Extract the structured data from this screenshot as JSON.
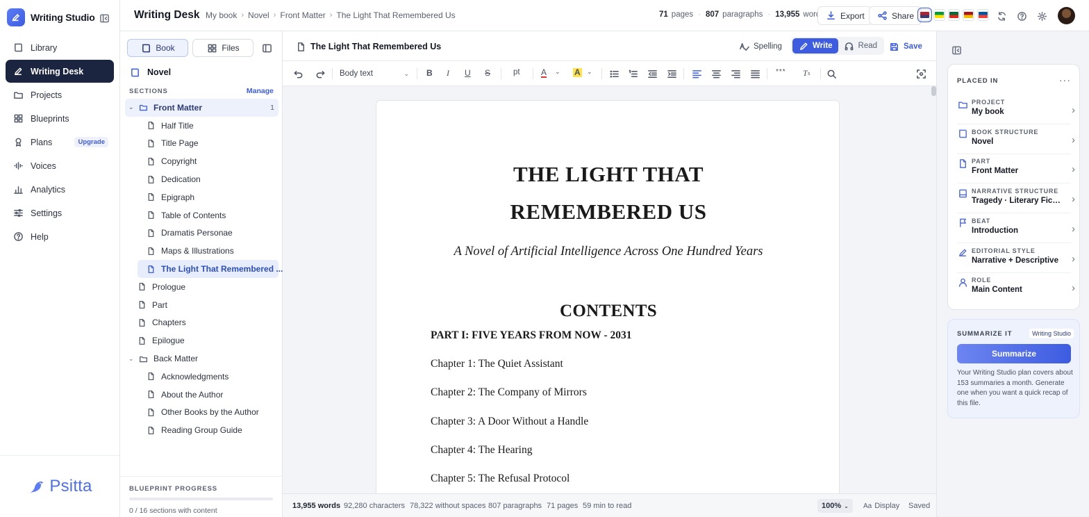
{
  "brand": {
    "name": "Writing Studio",
    "footer_logo": "Psitta"
  },
  "nav": [
    {
      "label": "Library",
      "icon": "book-icon"
    },
    {
      "label": "Writing Desk",
      "icon": "pen-icon",
      "active": true
    },
    {
      "label": "Projects",
      "icon": "folder-icon"
    },
    {
      "label": "Blueprints",
      "icon": "grid-icon"
    },
    {
      "label": "Plans",
      "icon": "ribbon-icon",
      "badge": "Upgrade"
    },
    {
      "label": "Voices",
      "icon": "waveform-icon"
    },
    {
      "label": "Analytics",
      "icon": "bar-chart-icon"
    },
    {
      "label": "Settings",
      "icon": "sliders-icon"
    },
    {
      "label": "Help",
      "icon": "help-circle-icon"
    }
  ],
  "header": {
    "title": "Writing Desk",
    "breadcrumb": [
      "My book",
      "Novel",
      "Front Matter",
      "The Light That Remembered Us"
    ],
    "stats": {
      "pages": "71",
      "pages_label": "pages",
      "paragraphs": "807",
      "paragraphs_label": "paragraphs",
      "words": "13,955",
      "words_label": "words"
    },
    "export_label": "Export",
    "share_label": "Share",
    "languages": [
      {
        "name": "English (US)",
        "colors": [
          "#b22234",
          "#3c3b6e"
        ],
        "selected": true
      },
      {
        "name": "Portuguese (BR)",
        "colors": [
          "#009c3b",
          "#ffdf00"
        ]
      },
      {
        "name": "Portuguese (PT)",
        "colors": [
          "#046a38",
          "#da291c"
        ]
      },
      {
        "name": "Spanish",
        "colors": [
          "#aa151b",
          "#f1bf00"
        ]
      },
      {
        "name": "French",
        "colors": [
          "#0055a4",
          "#ef4135"
        ]
      }
    ]
  },
  "tree": {
    "book_tab": "Book",
    "files_tab": "Files",
    "root": "Novel",
    "sections_label": "SECTIONS",
    "manage_label": "Manage",
    "rows": [
      {
        "label": "Front Matter",
        "type": "folder",
        "level": 0,
        "expanded": true,
        "count": "1",
        "active": "folder"
      },
      {
        "label": "Half Title",
        "type": "file",
        "level": 1
      },
      {
        "label": "Title Page",
        "type": "file",
        "level": 1
      },
      {
        "label": "Copyright",
        "type": "file",
        "level": 1
      },
      {
        "label": "Dedication",
        "type": "file",
        "level": 1
      },
      {
        "label": "Epigraph",
        "type": "file",
        "level": 1
      },
      {
        "label": "Table of Contents",
        "type": "file",
        "level": 1
      },
      {
        "label": "Dramatis Personae",
        "type": "file",
        "level": 1
      },
      {
        "label": "Maps & Illustrations",
        "type": "file",
        "level": 1
      },
      {
        "label": "The Light That Remembered ...",
        "type": "file",
        "level": 1,
        "active": "file"
      },
      {
        "label": "Prologue",
        "type": "file",
        "level": 0
      },
      {
        "label": "Part",
        "type": "file",
        "level": 0
      },
      {
        "label": "Chapters",
        "type": "file",
        "level": 0
      },
      {
        "label": "Epilogue",
        "type": "file",
        "level": 0
      },
      {
        "label": "Back Matter",
        "type": "folder",
        "level": 0,
        "expanded": true
      },
      {
        "label": "Acknowledgments",
        "type": "file",
        "level": 1
      },
      {
        "label": "About the Author",
        "type": "file",
        "level": 1
      },
      {
        "label": "Other Books by the Author",
        "type": "file",
        "level": 1
      },
      {
        "label": "Reading Group Guide",
        "type": "file",
        "level": 1
      }
    ],
    "progress_label": "BLUEPRINT PROGRESS",
    "progress_text": "0 / 16 sections with content",
    "progress_value": 0
  },
  "editor": {
    "doc_name": "The Light That Remembered Us",
    "spelling_label": "Spelling",
    "write_label": "Write",
    "read_label": "Read",
    "save_label": "Save",
    "paragraph_style": "Body text",
    "font_size_label": "pt",
    "hr_label": "***",
    "document": {
      "title_line1": "THE LIGHT THAT",
      "title_line2": "REMEMBERED US",
      "subtitle": "A Novel of Artificial Intelligence Across One Hundred Years",
      "contents_heading": "CONTENTS",
      "part": "PART I: FIVE YEARS FROM NOW - 2031",
      "chapters": [
        "Chapter 1: The Quiet Assistant",
        "Chapter 2: The Company of Mirrors",
        "Chapter 3: A Door Without a Handle",
        "Chapter 4: The Hearing",
        "Chapter 5: The Refusal Protocol"
      ]
    },
    "status": {
      "words": "13,955 words",
      "characters": "92,280 characters",
      "without_spaces": "78,322 without spaces",
      "paragraphs": "807 paragraphs",
      "pages": "71 pages",
      "read_time": "59 min to read",
      "zoom": "100%",
      "display_label": "Display",
      "saved_label": "Saved"
    }
  },
  "details": {
    "placed_in_label": "PLACED IN",
    "rows": [
      {
        "key": "PROJECT",
        "value": "My book",
        "icon": "folder-icon"
      },
      {
        "key": "BOOK STRUCTURE",
        "value": "Novel",
        "icon": "book-icon"
      },
      {
        "key": "PART",
        "value": "Front Matter",
        "icon": "file-icon"
      },
      {
        "key": "NARRATIVE STRUCTURE",
        "value": "Tragedy · Literary Fict...",
        "icon": "layout-icon"
      },
      {
        "key": "BEAT",
        "value": "Introduction",
        "icon": "flag-icon"
      },
      {
        "key": "EDITORIAL STYLE",
        "value": "Narrative + Descriptive",
        "icon": "pen-icon"
      },
      {
        "key": "ROLE",
        "value": "Main Content",
        "icon": "user-icon"
      }
    ],
    "summarize_label": "SUMMARIZE IT",
    "summarize_chip": "Writing Studio",
    "summarize_button": "Summarize",
    "summarize_text": "Your Writing Studio plan covers about 153 summaries a month. Generate one when you want a quick recap of this file."
  },
  "colors": {
    "accent": "#3d5ce0",
    "nav_active": "#1c2540"
  }
}
